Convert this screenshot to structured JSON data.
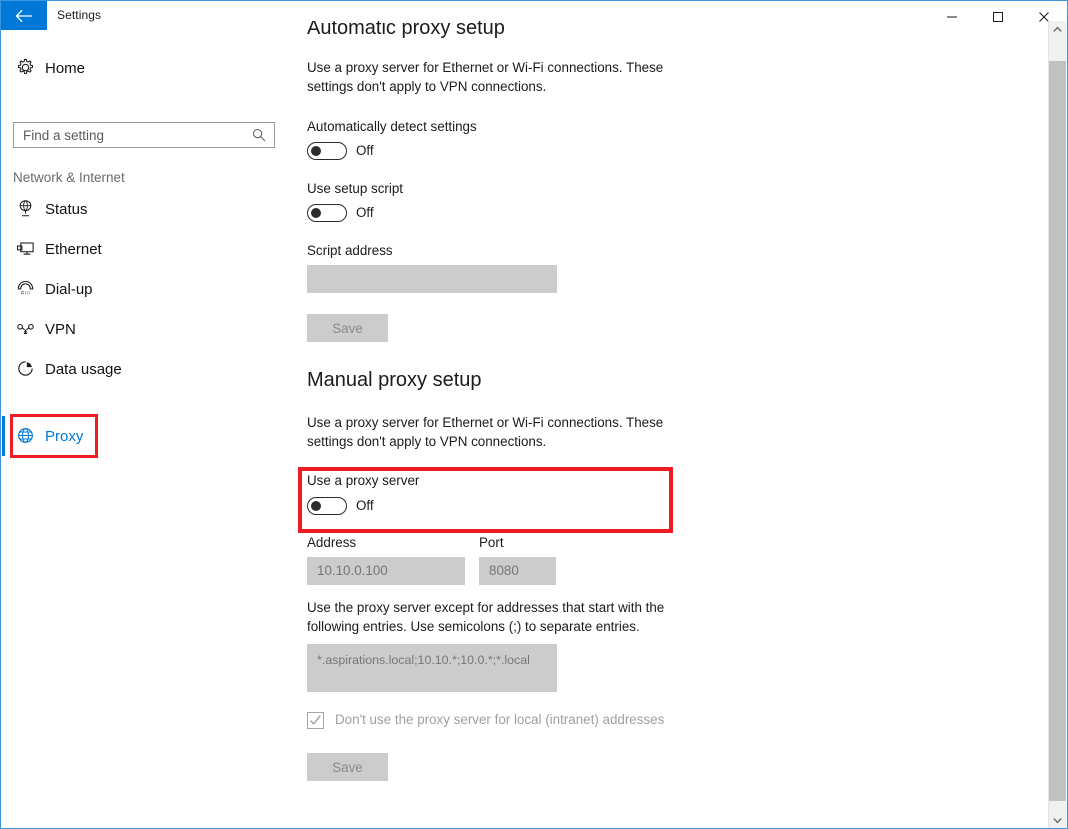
{
  "window": {
    "app_title": "Settings",
    "back_icon": "back-arrow-icon",
    "minimize_label": "–",
    "maximize_label": "□",
    "close_label": "✕",
    "accent_color": "#0078d7",
    "highlight_color": "#ee1c25"
  },
  "sidebar": {
    "home": {
      "label": "Home",
      "icon": "gear-icon"
    },
    "search": {
      "placeholder": "Find a setting",
      "value": "",
      "icon": "search-icon"
    },
    "category": "Network & Internet",
    "items": [
      {
        "label": "Status",
        "icon": "network-status-icon",
        "selected": false
      },
      {
        "label": "Ethernet",
        "icon": "monitor-icon",
        "selected": false
      },
      {
        "label": "Dial-up",
        "icon": "phone-icon",
        "selected": false
      },
      {
        "label": "VPN",
        "icon": "vpn-key-icon",
        "selected": false
      },
      {
        "label": "Data usage",
        "icon": "pie-chart-icon",
        "selected": false
      },
      {
        "label": "Proxy",
        "icon": "globe-icon",
        "selected": true
      }
    ]
  },
  "content": {
    "automatic": {
      "heading": "Automatic proxy setup",
      "description": "Use a proxy server for Ethernet or Wi-Fi connections. These settings don't apply to VPN connections.",
      "auto_detect_label": "Automatically detect settings",
      "auto_detect_state": "Off",
      "setup_script_label": "Use setup script",
      "setup_script_state": "Off",
      "script_address_label": "Script address",
      "script_address_value": "",
      "save_label": "Save"
    },
    "manual": {
      "heading": "Manual proxy setup",
      "description": "Use a proxy server for Ethernet or Wi-Fi connections. These settings don't apply to VPN connections.",
      "use_proxy_label": "Use a proxy server",
      "use_proxy_state": "Off",
      "address_label": "Address",
      "address_value": "10.10.0.100",
      "port_label": "Port",
      "port_value": "8080",
      "exceptions_description": "Use the proxy server except for addresses that start with the following entries. Use semicolons (;) to separate entries.",
      "exceptions_value": "*.aspirations.local;10.10.*;10.0.*;*.local",
      "bypass_local_label": "Don't use the proxy server for local (intranet) addresses",
      "save_label": "Save"
    }
  },
  "scrollbar": {
    "up_arrow": "chevron-up-icon",
    "down_arrow": "chevron-down-icon"
  }
}
